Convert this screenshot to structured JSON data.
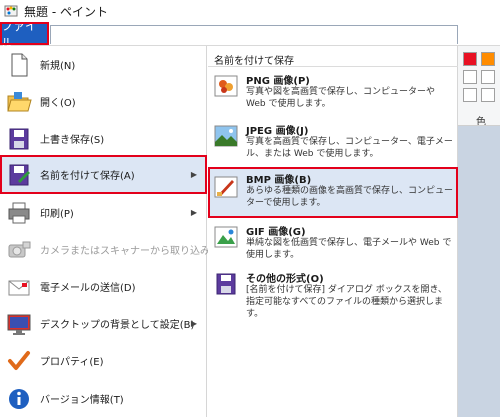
{
  "window": {
    "title": "無題 - ペイント"
  },
  "ribbon": {
    "file_tab": "ファイル",
    "color_label": "色"
  },
  "palette": {
    "swatches": [
      "#e81123",
      "#ff8c00",
      "#ffffff",
      "#ffffff",
      "#ffffff",
      "#ffffff"
    ]
  },
  "menu": {
    "items": [
      {
        "label": "新規(N)"
      },
      {
        "label": "開く(O)"
      },
      {
        "label": "上書き保存(S)"
      },
      {
        "label": "名前を付けて保存(A)"
      },
      {
        "label": "印刷(P)"
      },
      {
        "label": "カメラまたはスキャナーから取り込み(M)"
      },
      {
        "label": "電子メールの送信(D)"
      },
      {
        "label": "デスクトップの背景として設定(B)"
      },
      {
        "label": "プロパティ(E)"
      },
      {
        "label": "バージョン情報(T)"
      }
    ]
  },
  "submenu": {
    "header": "名前を付けて保存",
    "items": [
      {
        "title": "PNG 画像(P)",
        "desc": "写真や図を高画質で保存し、コンピューターや Web で使用します。"
      },
      {
        "title": "JPEG 画像(J)",
        "desc": "写真を高画質で保存し、コンピューター、電子メール、または Web で使用します。"
      },
      {
        "title": "BMP 画像(B)",
        "desc": "あらゆる種類の画像を高画質で保存し、コンピューターで使用します。"
      },
      {
        "title": "GIF 画像(G)",
        "desc": "単純な図を低画質で保存し、電子メールや Web で使用します。"
      },
      {
        "title": "その他の形式(O)",
        "desc": "[名前を付けて保存] ダイアログ ボックスを開き、指定可能なすべてのファイルの種類から選択します。"
      }
    ]
  }
}
